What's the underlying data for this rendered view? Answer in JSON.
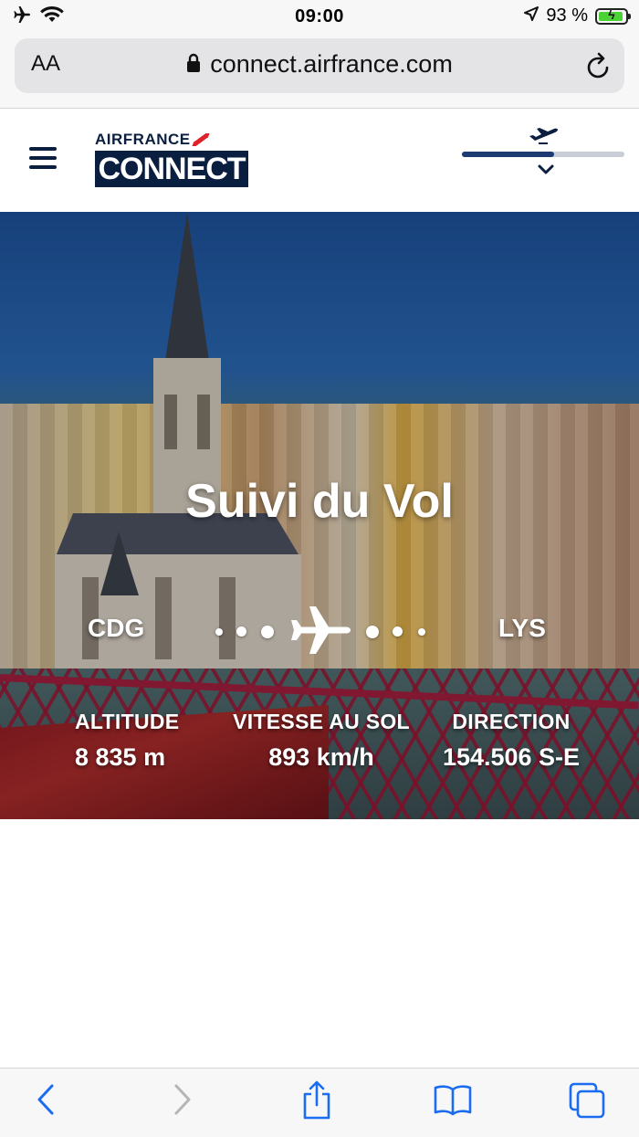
{
  "status_bar": {
    "time": "09:00",
    "battery_percent": "93 %",
    "battery_level": 0.93,
    "icons": [
      "airplane-mode-icon",
      "wifi-icon",
      "location-arrow-icon",
      "battery-charging-icon"
    ]
  },
  "browser": {
    "text_size_label": "AA",
    "url": "connect.airfrance.com",
    "icons": [
      "lock-icon",
      "reload-icon"
    ]
  },
  "header": {
    "logo_top": "AIRFRANCE",
    "logo_bottom": "CONNECT",
    "flight_progress": 0.57,
    "icons": [
      "menu-icon",
      "takeoff-icon",
      "chevron-down-icon"
    ]
  },
  "hero": {
    "title": "Suivi du Vol",
    "origin": "CDG",
    "destination": "LYS",
    "stats": [
      {
        "label": "ALTITUDE",
        "value": "8 835 m"
      },
      {
        "label": "VITESSE AU SOL",
        "value": "893 km/h"
      },
      {
        "label": "DIRECTION",
        "value": "154.506 S-E"
      }
    ]
  },
  "toolbar": {
    "icons": [
      "back-icon",
      "forward-icon",
      "share-icon",
      "bookmarks-icon",
      "tabs-icon"
    ]
  },
  "colors": {
    "brand_navy": "#0a1e40",
    "brand_red": "#e0232a",
    "progress_fill": "#1d3b72",
    "ios_blue": "#1a6cf0"
  }
}
